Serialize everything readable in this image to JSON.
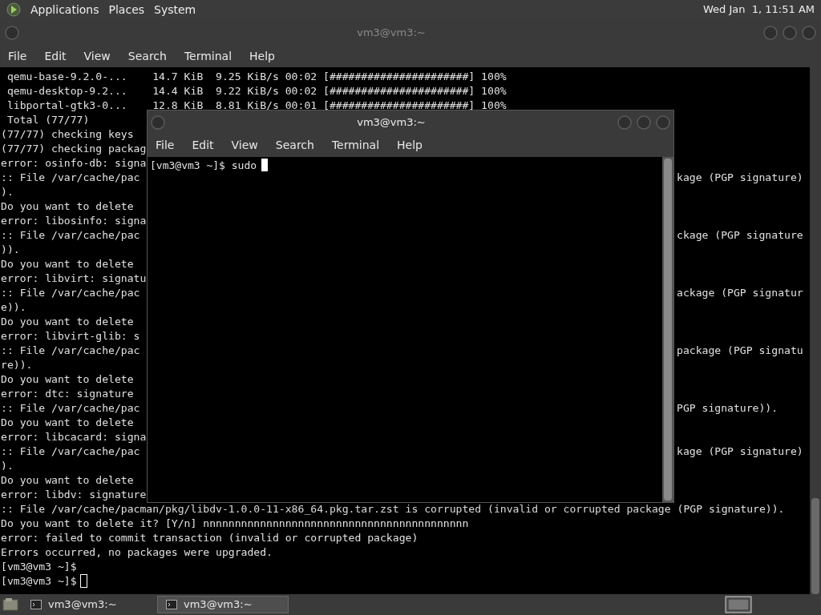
{
  "top_panel": {
    "menus": [
      "Applications",
      "Places",
      "System"
    ],
    "clock": "Wed Jan  1, 11:51 AM"
  },
  "background_window": {
    "title": "vm3@vm3:~",
    "menu": [
      "File",
      "Edit",
      "View",
      "Search",
      "Terminal",
      "Help"
    ],
    "lines": [
      {
        "left": " qemu-base-9.2.0-...    14.7 KiB  9.25 KiB/s 00:02 [######################] 100%"
      },
      {
        "left": " qemu-desktop-9.2...    14.4 KiB  9.22 KiB/s 00:02 [######################] 100%"
      },
      {
        "left": " libportal-gtk3-0...    12.8 KiB  8.81 KiB/s 00:01 [######################] 100%"
      },
      {
        "left": " Total (77/77)"
      },
      {
        "left": "(77/77) checking keys"
      },
      {
        "left": "(77/77) checking packag"
      },
      {
        "left": "error: osinfo-db: signa"
      },
      {
        "left": ":: File /var/cache/pac",
        "right": "kage (PGP signature)"
      },
      {
        "left": ")."
      },
      {
        "left": "Do you want to delete"
      },
      {
        "left": "error: libosinfo: signa"
      },
      {
        "left": ":: File /var/cache/pac",
        "right": "ckage (PGP signature"
      },
      {
        "left": "))."
      },
      {
        "left": "Do you want to delete"
      },
      {
        "left": "error: libvirt: signatu"
      },
      {
        "left": ":: File /var/cache/pac",
        "right": "ackage (PGP signatur"
      },
      {
        "left": "e))."
      },
      {
        "left": "Do you want to delete"
      },
      {
        "left": "error: libvirt-glib: s"
      },
      {
        "left": ":: File /var/cache/pac",
        "right": "package (PGP signatu"
      },
      {
        "left": "re))."
      },
      {
        "left": "Do you want to delete"
      },
      {
        "left": "error: dtc: signature"
      },
      {
        "left": ":: File /var/cache/pac",
        "right": "PGP signature))."
      },
      {
        "left": "Do you want to delete"
      },
      {
        "left": "error: libcacard: signa"
      },
      {
        "left": ":: File /var/cache/pac",
        "right": "kage (PGP signature)"
      },
      {
        "left": ")."
      },
      {
        "left": "Do you want to delete"
      },
      {
        "left": "error: libdv: signature"
      },
      {
        "left": ":: File /var/cache/pacman/pkg/libdv-1.0.0-11-x86_64.pkg.tar.zst is corrupted (invalid or corrupted package (PGP signature))."
      },
      {
        "left": "Do you want to delete it? [Y/n] nnnnnnnnnnnnnnnnnnnnnnnnnnnnnnnnnnnnnnnnnn"
      },
      {
        "left": "error: failed to commit transaction (invalid or corrupted package)"
      },
      {
        "left": "Errors occurred, no packages were upgraded."
      },
      {
        "left": "[vm3@vm3 ~]$"
      },
      {
        "left": "[vm3@vm3 ~]$"
      }
    ]
  },
  "foreground_window": {
    "title": "vm3@vm3:~",
    "menu": [
      "File",
      "Edit",
      "View",
      "Search",
      "Terminal",
      "Help"
    ],
    "lines": [
      "[vm3@vm3 ~]$ sudo"
    ]
  },
  "taskbar": {
    "items": [
      {
        "label": "vm3@vm3:~",
        "selected": false
      },
      {
        "label": "vm3@vm3:~",
        "selected": true
      }
    ]
  }
}
